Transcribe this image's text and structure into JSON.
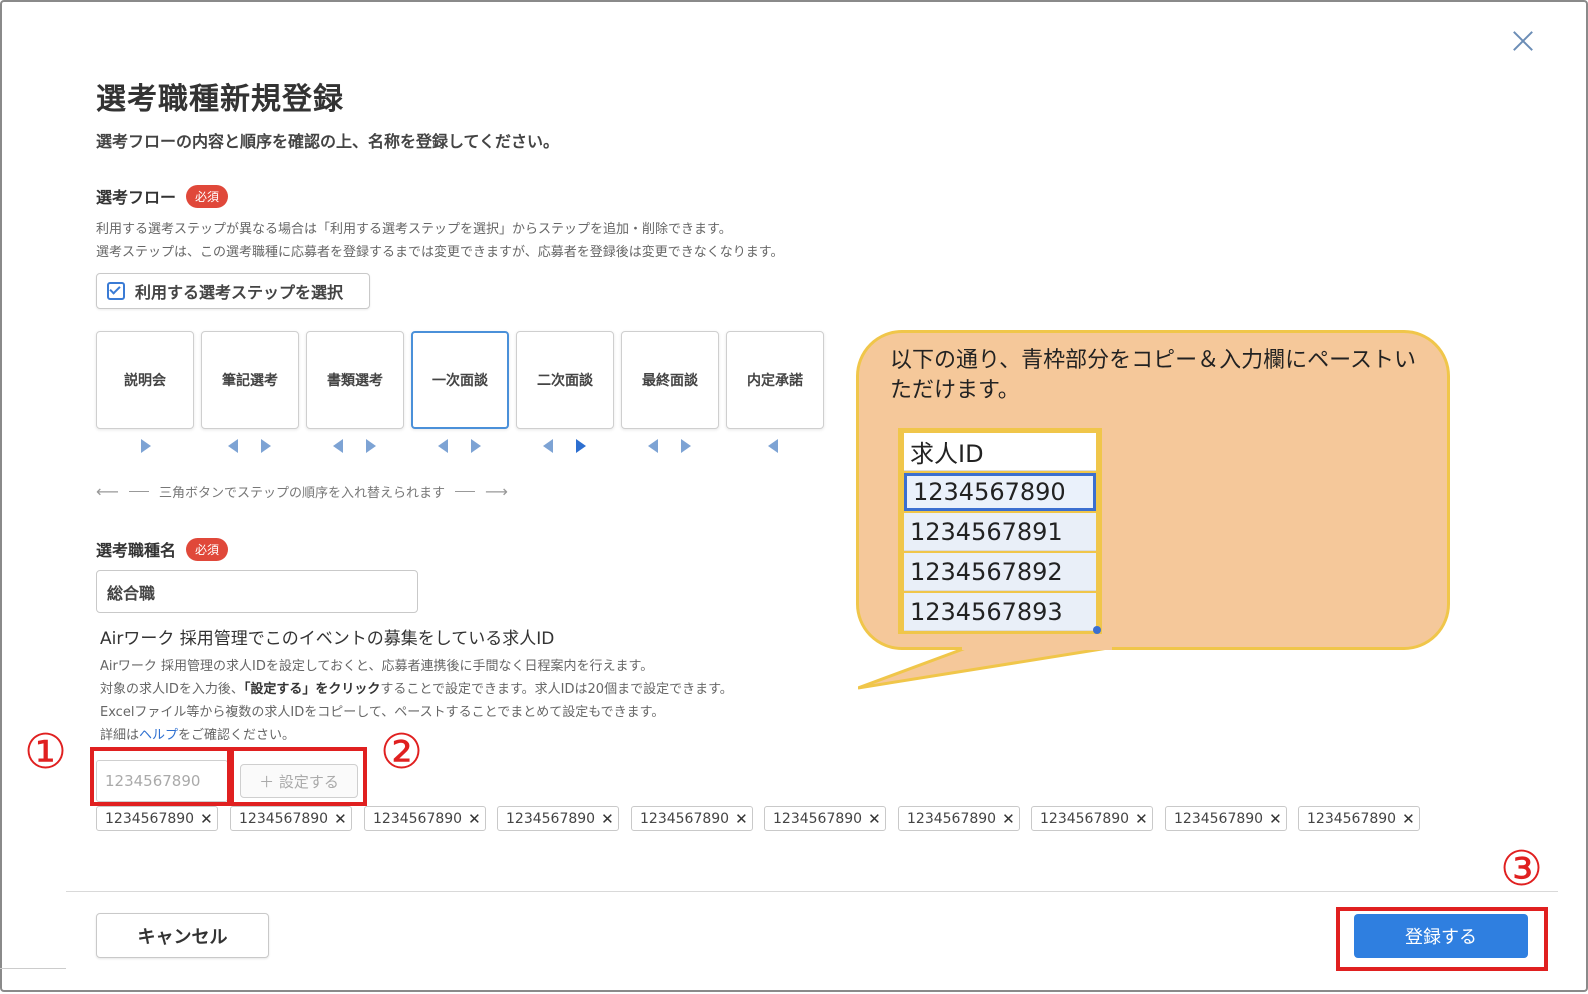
{
  "modal": {
    "title": "選考職種新規登録",
    "subtitle": "選考フローの内容と順序を確認の上、名称を登録してください。"
  },
  "flow": {
    "label": "選考フロー",
    "required_badge": "必須",
    "note_line1": "利用する選考ステップが異なる場合は「利用する選考ステップを選択」からステップを追加・削除できます。",
    "note_line2": "選考ステップは、この選考職種に応募者を登録するまでは変更できますが、応募者を登録後は変更できなくなります。",
    "select_button": "利用する選考ステップを選択",
    "steps": [
      {
        "label": "説明会"
      },
      {
        "label": "筆記選考"
      },
      {
        "label": "書類選考"
      },
      {
        "label": "一次面談"
      },
      {
        "label": "二次面談"
      },
      {
        "label": "最終面談"
      },
      {
        "label": "内定承諾"
      }
    ],
    "active_step": "一次面談",
    "reorder_hint": "三角ボタンでステップの順序を入れ替えられます"
  },
  "job_name": {
    "label": "選考職種名",
    "required_badge": "必須",
    "value": "総合職"
  },
  "airwork": {
    "title": "Airワーク 採用管理でこのイベントの募集をしている求人ID",
    "note_line1": "Airワーク 採用管理の求人IDを設定しておくと、応募者連携後に手間なく日程案内を行えます。",
    "note_line2_pre": "対象の求人IDを入力後、",
    "note_line2_bold": "「設定する」をクリック",
    "note_line2_post": "することで設定できます。求人IDは20個まで設定できます。",
    "note_line3": "Excelファイル等から複数の求人IDをコピーして、ペーストすることでまとめて設定もできます。",
    "note_line4_pre": "詳細は",
    "note_line4_link": "ヘルプ",
    "note_line4_post": "をご確認ください。",
    "input_placeholder": "1234567890",
    "set_button": "＋ 設定する",
    "chips": [
      "1234567890",
      "1234567890",
      "1234567890",
      "1234567890",
      "1234567890",
      "1234567890",
      "1234567890",
      "1234567890",
      "1234567890",
      "1234567890"
    ],
    "chip_remove": "✕"
  },
  "footer": {
    "cancel": "キャンセル",
    "submit": "登録する"
  },
  "annotations": {
    "marker1": "①",
    "marker2": "②",
    "marker3": "③",
    "callout_text": "以下の通り、青枠部分をコピー＆入力欄にペーストいただけます。",
    "sheet_header": "求人ID",
    "sheet_rows": [
      "1234567890",
      "1234567891",
      "1234567892",
      "1234567893"
    ],
    "highlight_color": "#e02020"
  },
  "colors": {
    "accent": "#2f7fe0",
    "required": "#e0483a",
    "callout_fill": "#f5c89a",
    "callout_border": "#f0c64a"
  }
}
